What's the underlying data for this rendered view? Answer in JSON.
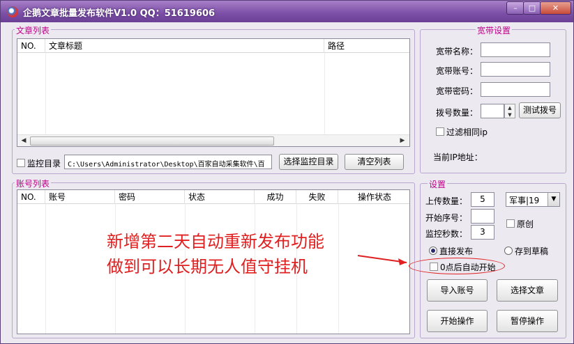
{
  "window": {
    "title": "企鹅文章批量发布软件V1.0 QQ：51619606",
    "min_label": "–",
    "max_label": "□",
    "close_label": "✕"
  },
  "articles": {
    "group_label": "文章列表",
    "columns": [
      "NO.",
      "文章标题",
      "路径"
    ],
    "rows": [],
    "monitor_checkbox_label": "监控目录",
    "monitor_checked": false,
    "monitor_path": "C:\\Users\\Administrator\\Desktop\\百家自动采集软件\\百",
    "select_dir_button": "选择监控目录",
    "clear_list_button": "清空列表"
  },
  "accounts": {
    "group_label": "账号列表",
    "columns": [
      "NO.",
      "账号",
      "密码",
      "状态",
      "成功",
      "失败",
      "操作状态"
    ],
    "rows": []
  },
  "broadband": {
    "group_label": "宽带设置",
    "name_label": "宽带名称：",
    "name_value": "",
    "account_label": "宽带账号：",
    "account_value": "",
    "password_label": "宽带密码：",
    "password_value": "",
    "dial_count_label": "拨号数量：",
    "dial_count_value": "",
    "test_dial_button": "测试拨号",
    "filter_ip_label": "过滤相同ip",
    "filter_ip_checked": false,
    "current_ip_label": "当前IP地址："
  },
  "settings": {
    "group_label": "设置",
    "upload_count_label": "上传数量：",
    "upload_count_value": "5",
    "category_value": "军事|19",
    "start_index_label": "开始序号：",
    "start_index_value": "",
    "monitor_seconds_label": "监控秒数：",
    "monitor_seconds_value": "3",
    "original_label": "原创",
    "original_checked": false,
    "publish_direct_label": "直接发布",
    "save_draft_label": "存到草稿",
    "publish_mode": "direct",
    "auto_start_label": "0点后自动开始",
    "auto_start_checked": false,
    "import_accounts_button": "导入账号",
    "select_articles_button": "选择文章",
    "start_button": "开始操作",
    "pause_button": "暂停操作"
  },
  "annotation": {
    "line1": "新增第二天自动重新发布功能",
    "line2": "做到可以长期无人值守挂机",
    "color": "#e02020"
  }
}
